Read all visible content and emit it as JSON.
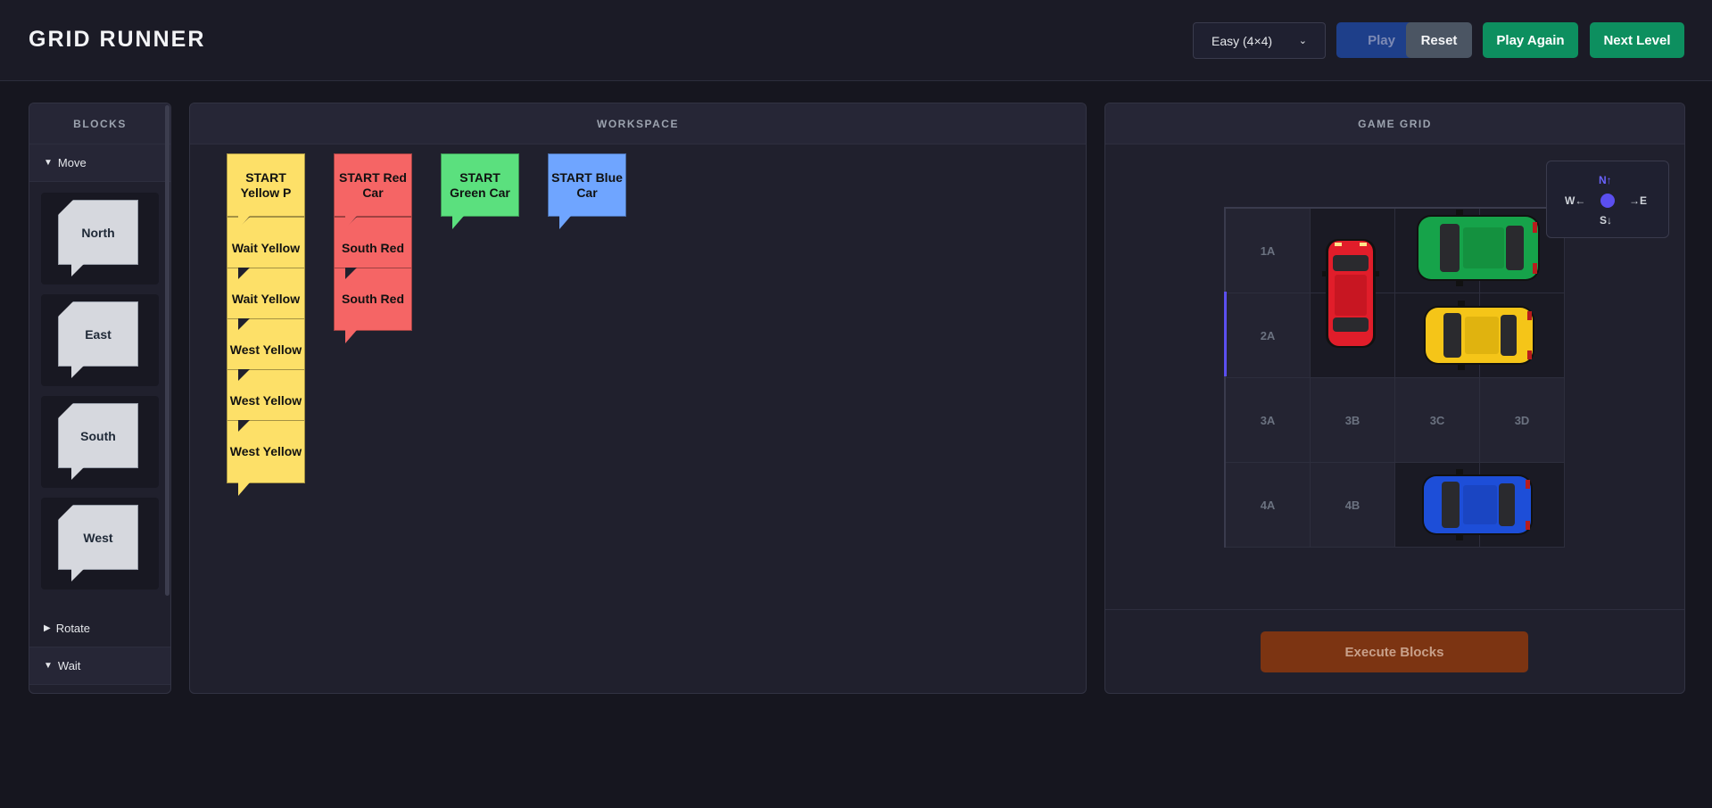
{
  "header": {
    "title": "GRID RUNNER",
    "difficulty": "Easy (4×4)",
    "play": "Play",
    "reset": "Reset",
    "play_again": "Play Again",
    "next_level": "Next Level"
  },
  "blocks_panel": {
    "title": "BLOCKS",
    "categories": [
      {
        "label": "Move",
        "expanded": true,
        "items": [
          "North",
          "East",
          "South",
          "West"
        ]
      },
      {
        "label": "Rotate",
        "expanded": false
      },
      {
        "label": "Wait",
        "expanded": true
      }
    ]
  },
  "workspace": {
    "title": "WORKSPACE",
    "stacks": [
      {
        "color": "#fde068",
        "start": "START Yellow P",
        "commands": [
          "Wait Yellow",
          "Wait Yellow",
          "West Yellow",
          "West Yellow",
          "West Yellow"
        ]
      },
      {
        "color": "#f56565",
        "start": "START Red Car",
        "commands": [
          "South Red",
          "South Red"
        ]
      },
      {
        "color": "#5be07e",
        "start": "START Green Car",
        "commands": []
      },
      {
        "color": "#6fa5ff",
        "start": "START Blue Car",
        "commands": []
      }
    ]
  },
  "game_grid": {
    "title": "GAME GRID",
    "compass": {
      "n": "N↑",
      "w": "W←",
      "e": "→E",
      "s": "S↓"
    },
    "cells": [
      [
        "1A",
        "",
        "",
        ""
      ],
      [
        "2A",
        "",
        "",
        ""
      ],
      [
        "3A",
        "3B",
        "3C",
        "3D"
      ],
      [
        "4A",
        "4B",
        "",
        ""
      ]
    ],
    "cars": [
      {
        "name": "red",
        "color": "#e11d2a"
      },
      {
        "name": "green",
        "color": "#16a34a"
      },
      {
        "name": "yellow",
        "color": "#f5c518"
      },
      {
        "name": "blue",
        "color": "#1d4ed8"
      }
    ],
    "execute": "Execute Blocks"
  }
}
